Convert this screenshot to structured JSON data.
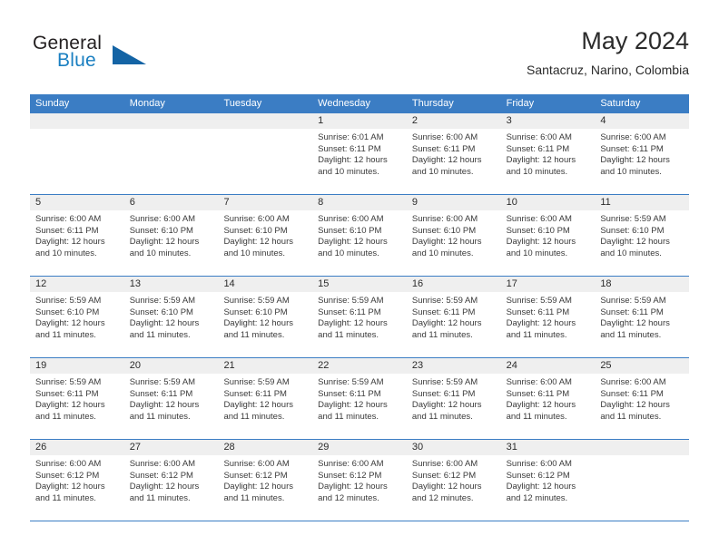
{
  "logo": {
    "word_top": "General",
    "word_bottom": "Blue",
    "shape": "triangle-icon"
  },
  "header": {
    "title": "May 2024",
    "subtitle": "Santacruz, Narino, Colombia"
  },
  "calendar": {
    "weekday_headers": [
      "Sunday",
      "Monday",
      "Tuesday",
      "Wednesday",
      "Thursday",
      "Friday",
      "Saturday"
    ],
    "accent_color": "#3b7dc4",
    "date_strip_color": "#efefef",
    "weeks": [
      [
        {
          "date": "",
          "lines": []
        },
        {
          "date": "",
          "lines": []
        },
        {
          "date": "",
          "lines": []
        },
        {
          "date": "1",
          "lines": [
            "Sunrise: 6:01 AM",
            "Sunset: 6:11 PM",
            "Daylight: 12 hours",
            "and 10 minutes."
          ]
        },
        {
          "date": "2",
          "lines": [
            "Sunrise: 6:00 AM",
            "Sunset: 6:11 PM",
            "Daylight: 12 hours",
            "and 10 minutes."
          ]
        },
        {
          "date": "3",
          "lines": [
            "Sunrise: 6:00 AM",
            "Sunset: 6:11 PM",
            "Daylight: 12 hours",
            "and 10 minutes."
          ]
        },
        {
          "date": "4",
          "lines": [
            "Sunrise: 6:00 AM",
            "Sunset: 6:11 PM",
            "Daylight: 12 hours",
            "and 10 minutes."
          ]
        }
      ],
      [
        {
          "date": "5",
          "lines": [
            "Sunrise: 6:00 AM",
            "Sunset: 6:11 PM",
            "Daylight: 12 hours",
            "and 10 minutes."
          ]
        },
        {
          "date": "6",
          "lines": [
            "Sunrise: 6:00 AM",
            "Sunset: 6:10 PM",
            "Daylight: 12 hours",
            "and 10 minutes."
          ]
        },
        {
          "date": "7",
          "lines": [
            "Sunrise: 6:00 AM",
            "Sunset: 6:10 PM",
            "Daylight: 12 hours",
            "and 10 minutes."
          ]
        },
        {
          "date": "8",
          "lines": [
            "Sunrise: 6:00 AM",
            "Sunset: 6:10 PM",
            "Daylight: 12 hours",
            "and 10 minutes."
          ]
        },
        {
          "date": "9",
          "lines": [
            "Sunrise: 6:00 AM",
            "Sunset: 6:10 PM",
            "Daylight: 12 hours",
            "and 10 minutes."
          ]
        },
        {
          "date": "10",
          "lines": [
            "Sunrise: 6:00 AM",
            "Sunset: 6:10 PM",
            "Daylight: 12 hours",
            "and 10 minutes."
          ]
        },
        {
          "date": "11",
          "lines": [
            "Sunrise: 5:59 AM",
            "Sunset: 6:10 PM",
            "Daylight: 12 hours",
            "and 10 minutes."
          ]
        }
      ],
      [
        {
          "date": "12",
          "lines": [
            "Sunrise: 5:59 AM",
            "Sunset: 6:10 PM",
            "Daylight: 12 hours",
            "and 11 minutes."
          ]
        },
        {
          "date": "13",
          "lines": [
            "Sunrise: 5:59 AM",
            "Sunset: 6:10 PM",
            "Daylight: 12 hours",
            "and 11 minutes."
          ]
        },
        {
          "date": "14",
          "lines": [
            "Sunrise: 5:59 AM",
            "Sunset: 6:10 PM",
            "Daylight: 12 hours",
            "and 11 minutes."
          ]
        },
        {
          "date": "15",
          "lines": [
            "Sunrise: 5:59 AM",
            "Sunset: 6:11 PM",
            "Daylight: 12 hours",
            "and 11 minutes."
          ]
        },
        {
          "date": "16",
          "lines": [
            "Sunrise: 5:59 AM",
            "Sunset: 6:11 PM",
            "Daylight: 12 hours",
            "and 11 minutes."
          ]
        },
        {
          "date": "17",
          "lines": [
            "Sunrise: 5:59 AM",
            "Sunset: 6:11 PM",
            "Daylight: 12 hours",
            "and 11 minutes."
          ]
        },
        {
          "date": "18",
          "lines": [
            "Sunrise: 5:59 AM",
            "Sunset: 6:11 PM",
            "Daylight: 12 hours",
            "and 11 minutes."
          ]
        }
      ],
      [
        {
          "date": "19",
          "lines": [
            "Sunrise: 5:59 AM",
            "Sunset: 6:11 PM",
            "Daylight: 12 hours",
            "and 11 minutes."
          ]
        },
        {
          "date": "20",
          "lines": [
            "Sunrise: 5:59 AM",
            "Sunset: 6:11 PM",
            "Daylight: 12 hours",
            "and 11 minutes."
          ]
        },
        {
          "date": "21",
          "lines": [
            "Sunrise: 5:59 AM",
            "Sunset: 6:11 PM",
            "Daylight: 12 hours",
            "and 11 minutes."
          ]
        },
        {
          "date": "22",
          "lines": [
            "Sunrise: 5:59 AM",
            "Sunset: 6:11 PM",
            "Daylight: 12 hours",
            "and 11 minutes."
          ]
        },
        {
          "date": "23",
          "lines": [
            "Sunrise: 5:59 AM",
            "Sunset: 6:11 PM",
            "Daylight: 12 hours",
            "and 11 minutes."
          ]
        },
        {
          "date": "24",
          "lines": [
            "Sunrise: 6:00 AM",
            "Sunset: 6:11 PM",
            "Daylight: 12 hours",
            "and 11 minutes."
          ]
        },
        {
          "date": "25",
          "lines": [
            "Sunrise: 6:00 AM",
            "Sunset: 6:11 PM",
            "Daylight: 12 hours",
            "and 11 minutes."
          ]
        }
      ],
      [
        {
          "date": "26",
          "lines": [
            "Sunrise: 6:00 AM",
            "Sunset: 6:12 PM",
            "Daylight: 12 hours",
            "and 11 minutes."
          ]
        },
        {
          "date": "27",
          "lines": [
            "Sunrise: 6:00 AM",
            "Sunset: 6:12 PM",
            "Daylight: 12 hours",
            "and 11 minutes."
          ]
        },
        {
          "date": "28",
          "lines": [
            "Sunrise: 6:00 AM",
            "Sunset: 6:12 PM",
            "Daylight: 12 hours",
            "and 11 minutes."
          ]
        },
        {
          "date": "29",
          "lines": [
            "Sunrise: 6:00 AM",
            "Sunset: 6:12 PM",
            "Daylight: 12 hours",
            "and 12 minutes."
          ]
        },
        {
          "date": "30",
          "lines": [
            "Sunrise: 6:00 AM",
            "Sunset: 6:12 PM",
            "Daylight: 12 hours",
            "and 12 minutes."
          ]
        },
        {
          "date": "31",
          "lines": [
            "Sunrise: 6:00 AM",
            "Sunset: 6:12 PM",
            "Daylight: 12 hours",
            "and 12 minutes."
          ]
        },
        {
          "date": "",
          "lines": []
        }
      ]
    ]
  }
}
